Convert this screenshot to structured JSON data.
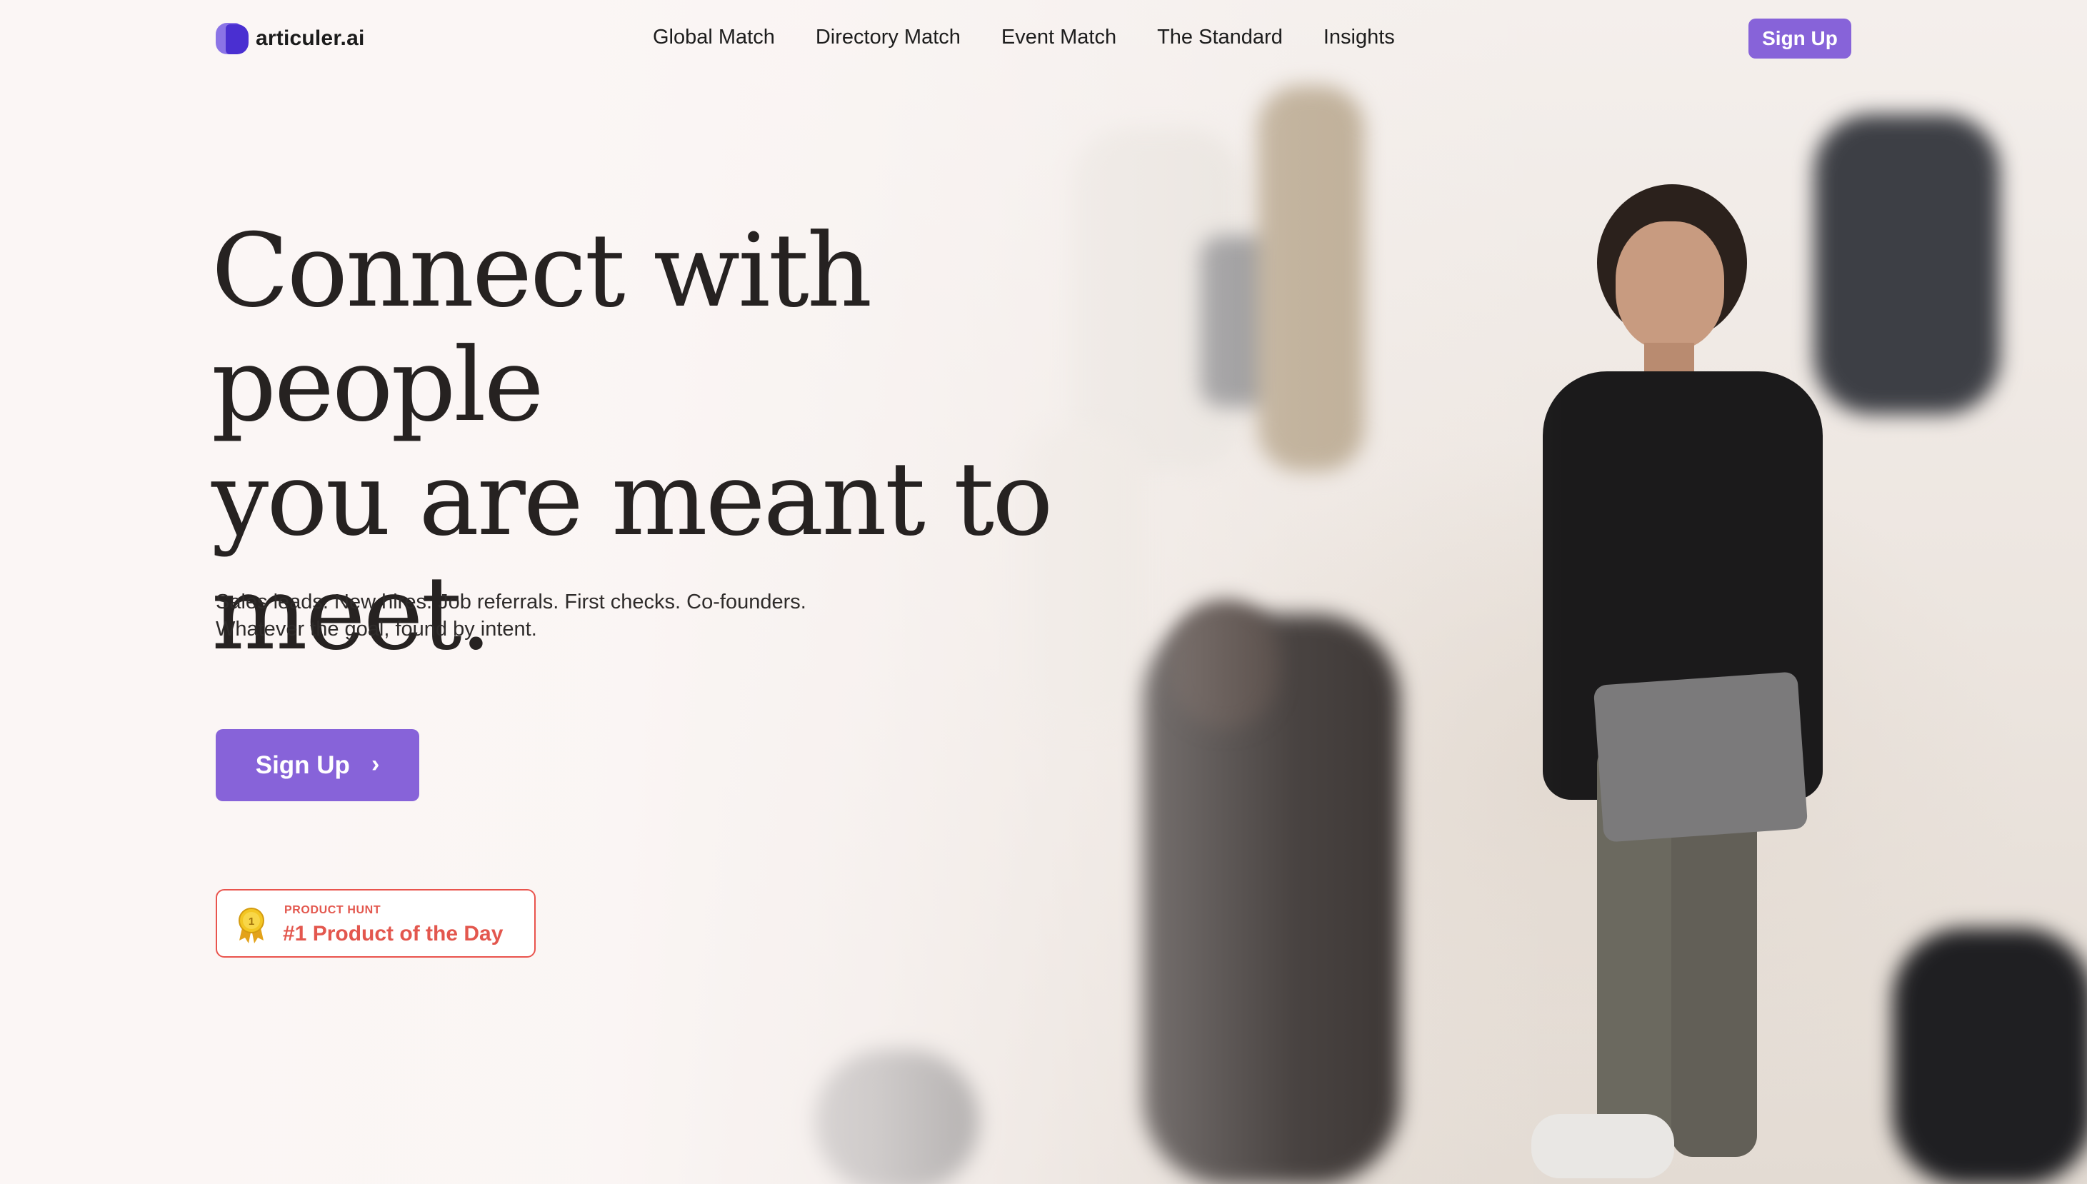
{
  "brand": {
    "name": "articuler.ai",
    "accent_color": "#8763d9",
    "logo_colors": [
      "#8b74e6",
      "#4a2fd1"
    ]
  },
  "nav": {
    "links": [
      {
        "label": "Global Match"
      },
      {
        "label": "Directory Match"
      },
      {
        "label": "Event Match"
      },
      {
        "label": "The Standard"
      },
      {
        "label": "Insights"
      }
    ],
    "signup_label": "Sign Up"
  },
  "hero": {
    "title_lines": [
      "Connect with people",
      "you are meant to",
      "meet."
    ],
    "subtitle_lines": [
      "Sales leads. New hires. Job referrals. First checks. Co-founders.",
      "Whatever the goal, found by intent."
    ],
    "cta_label": "Sign Up",
    "cta_icon": "chevron-right-icon"
  },
  "badge": {
    "kicker": "PRODUCT HUNT",
    "title": "#1 Product of the Day",
    "medal_number": "1",
    "color": "#e3574e"
  }
}
